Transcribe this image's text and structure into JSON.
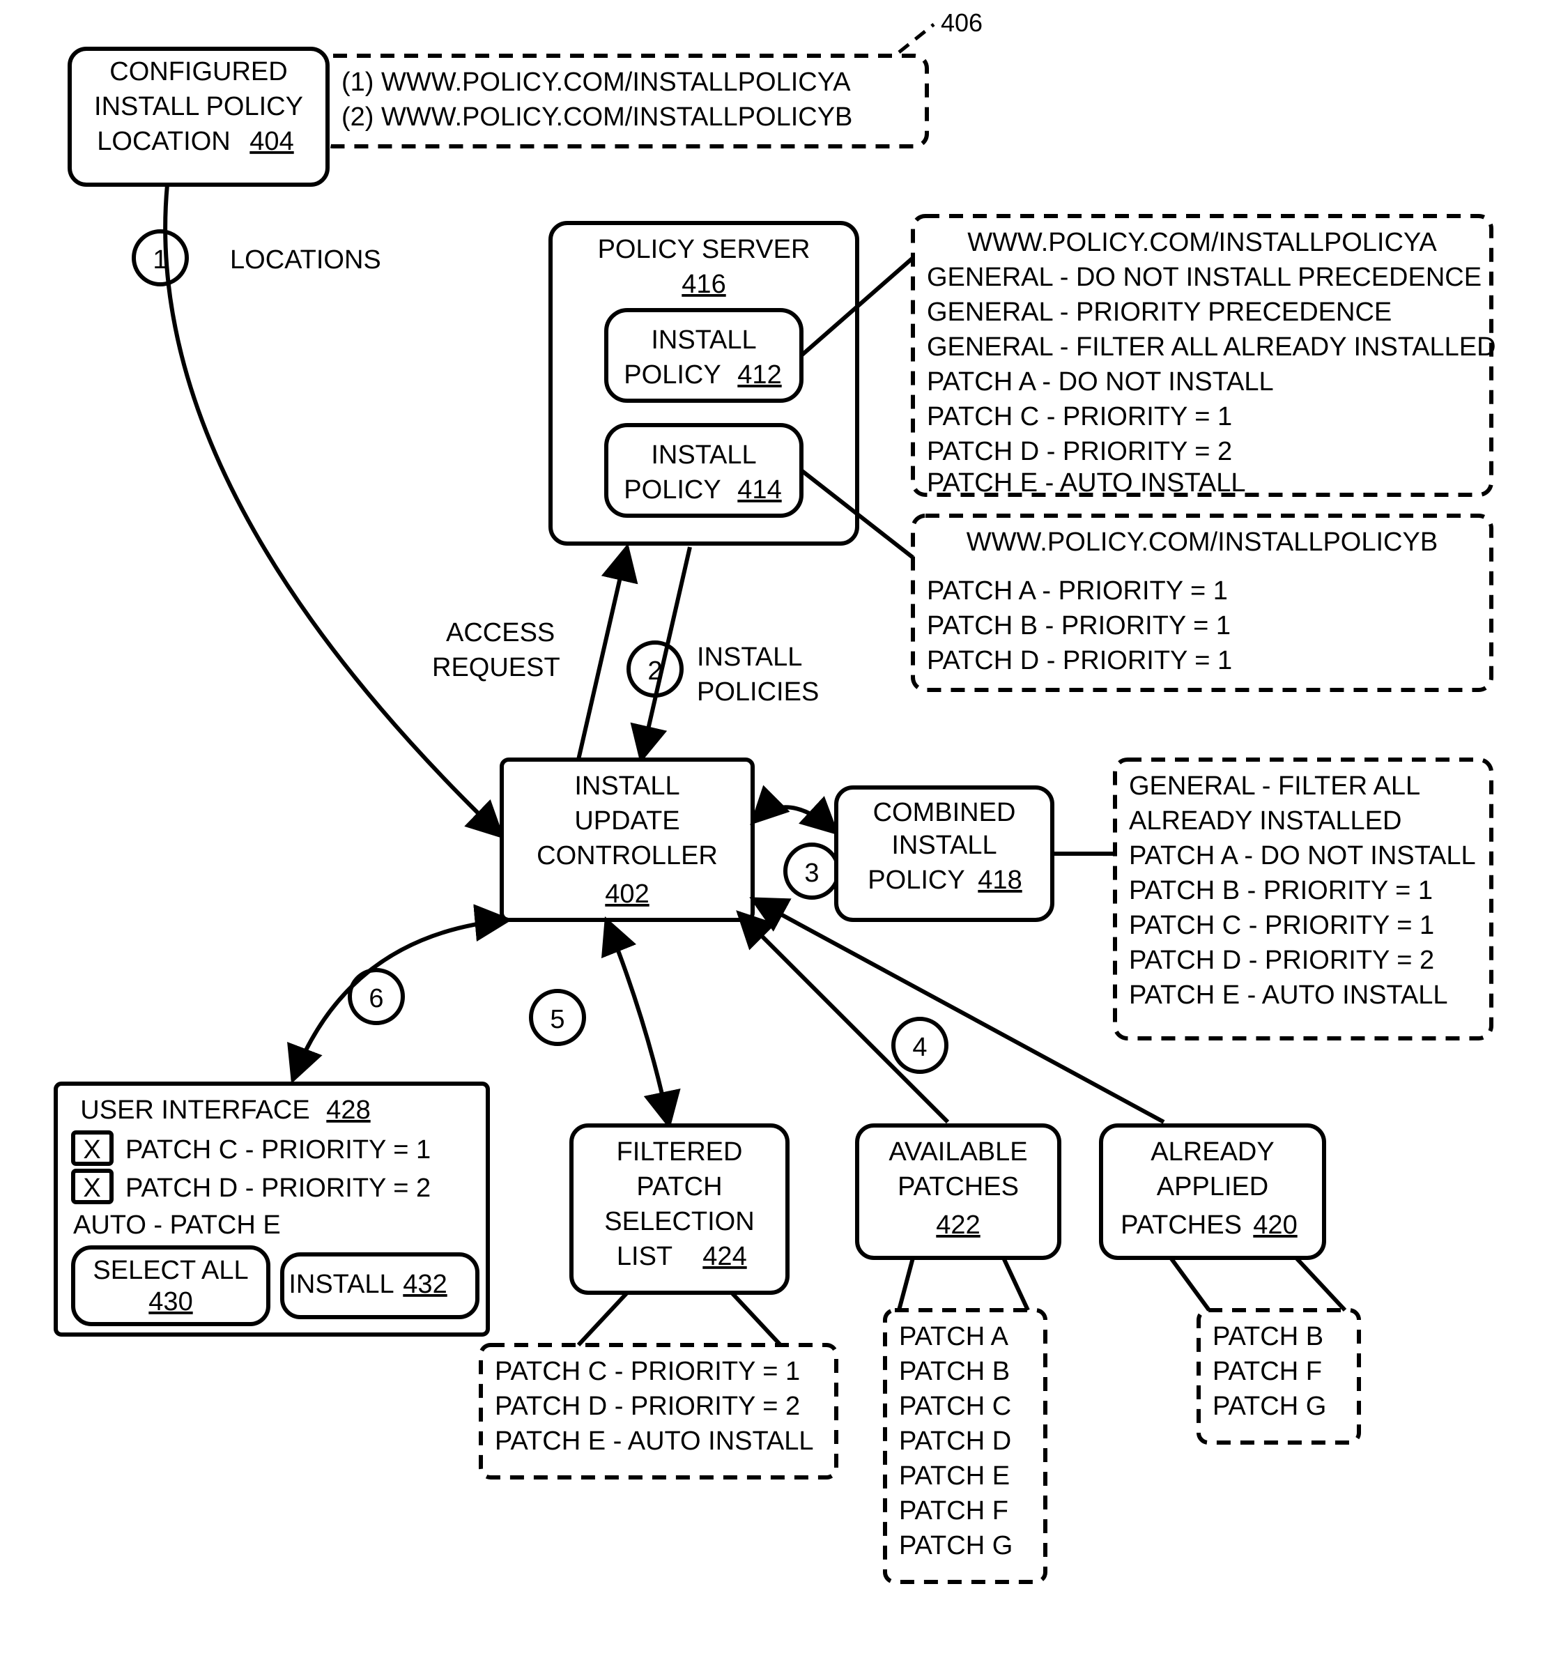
{
  "ref406": "406",
  "configBox": {
    "line1": "CONFIGURED",
    "line2": "INSTALL POLICY",
    "line3": "LOCATION",
    "ref": "404"
  },
  "urls": {
    "l1": "(1)  WWW.POLICY.COM/INSTALLPOLICYA",
    "l2": "(2)  WWW.POLICY.COM/INSTALLPOLICYB"
  },
  "step1": {
    "num": "1",
    "label": "LOCATIONS"
  },
  "policyServer": {
    "title": "POLICY SERVER",
    "ref": "416",
    "p1": {
      "l1": "INSTALL",
      "l2": "POLICY",
      "ref": "412"
    },
    "p2": {
      "l1": "INSTALL",
      "l2": "POLICY",
      "ref": "414"
    }
  },
  "policyA": {
    "title": "WWW.POLICY.COM/INSTALLPOLICYA",
    "lines": [
      "GENERAL - DO NOT INSTALL PRECEDENCE",
      "GENERAL - PRIORITY PRECEDENCE",
      "GENERAL - FILTER ALL ALREADY INSTALLED",
      "PATCH A - DO NOT INSTALL",
      "PATCH C - PRIORITY = 1",
      "PATCH D - PRIORITY = 2",
      "PATCH E - AUTO INSTALL"
    ]
  },
  "policyB": {
    "title": "WWW.POLICY.COM/INSTALLPOLICYB",
    "lines": [
      "PATCH A - PRIORITY = 1",
      "PATCH B - PRIORITY = 1",
      "PATCH D - PRIORITY = 1"
    ]
  },
  "step2": {
    "num": "2",
    "l1": "ACCESS",
    "l2": "REQUEST",
    "r1": "INSTALL",
    "r2": "POLICIES"
  },
  "controller": {
    "l1": "INSTALL",
    "l2": "UPDATE",
    "l3": "CONTROLLER",
    "ref": "402"
  },
  "step3": {
    "num": "3"
  },
  "combined": {
    "l1": "COMBINED",
    "l2": "INSTALL",
    "l3": "POLICY",
    "ref": "418"
  },
  "combinedDetail": [
    "GENERAL - FILTER ALL",
    "ALREADY INSTALLED",
    "PATCH A - DO NOT INSTALL",
    "PATCH B - PRIORITY = 1",
    "PATCH C - PRIORITY = 1",
    "PATCH D - PRIORITY = 2",
    "PATCH E - AUTO INSTALL"
  ],
  "step4": {
    "num": "4"
  },
  "step5": {
    "num": "5"
  },
  "step6": {
    "num": "6"
  },
  "ui": {
    "title": "USER INTERFACE",
    "ref": "428",
    "rows": [
      {
        "checked": "X",
        "text": "PATCH C - PRIORITY = 1"
      },
      {
        "checked": "X",
        "text": "PATCH D - PRIORITY = 2"
      }
    ],
    "auto": "AUTO - PATCH E",
    "selectAll": {
      "label": "SELECT ALL",
      "ref": "430"
    },
    "install": {
      "label": "INSTALL",
      "ref": "432"
    }
  },
  "filtered": {
    "l1": "FILTERED",
    "l2": "PATCH",
    "l3": "SELECTION",
    "l4": "LIST",
    "ref": "424",
    "detail": [
      "PATCH C - PRIORITY = 1",
      "PATCH D - PRIORITY = 2",
      "PATCH E - AUTO INSTALL"
    ]
  },
  "available": {
    "l1": "AVAILABLE",
    "l2": "PATCHES",
    "ref": "422",
    "detail": [
      "PATCH A",
      "PATCH B",
      "PATCH C",
      "PATCH D",
      "PATCH E",
      "PATCH F",
      "PATCH G"
    ]
  },
  "already": {
    "l1": "ALREADY",
    "l2": "APPLIED",
    "l3": "PATCHES",
    "ref": "420",
    "detail": [
      "PATCH B",
      "PATCH F",
      "PATCH G"
    ]
  }
}
